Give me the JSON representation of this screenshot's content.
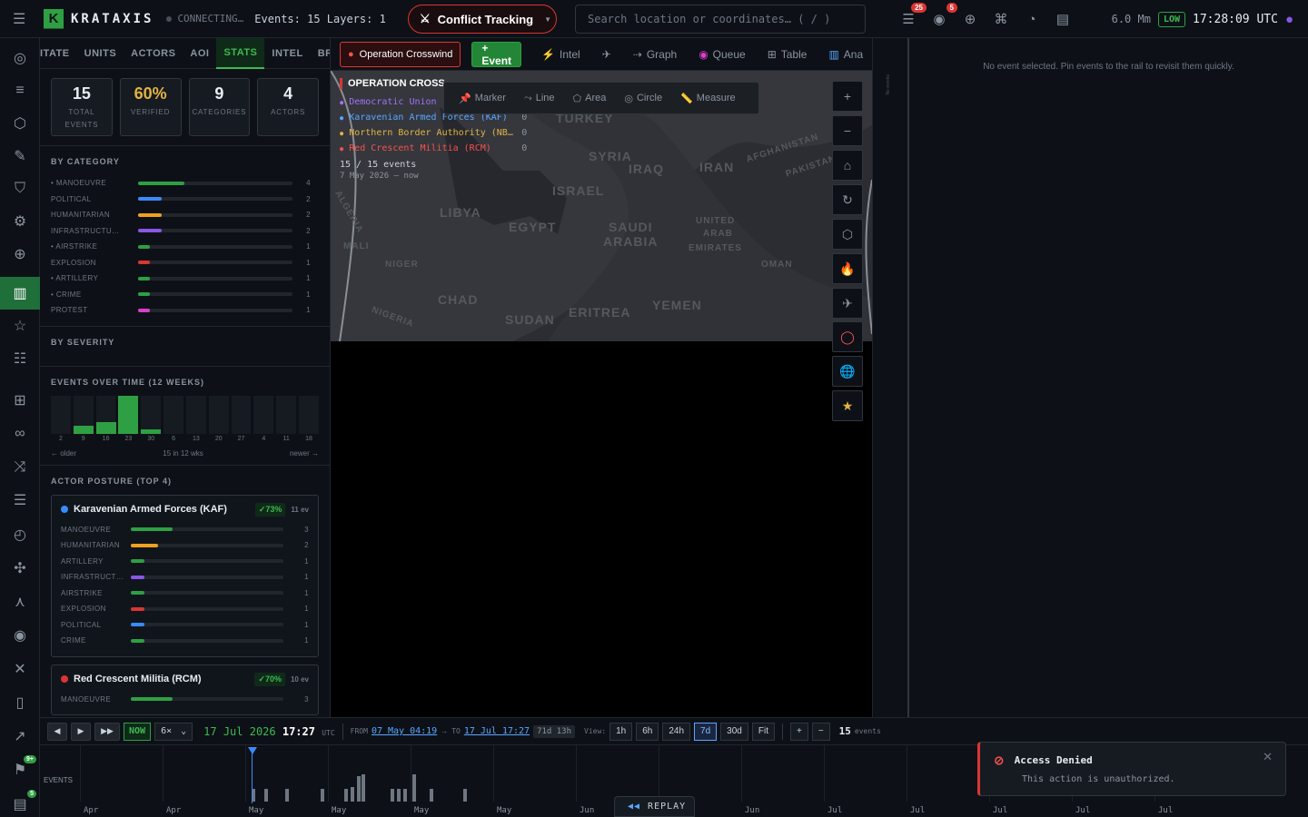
{
  "topbar": {
    "app_name": "KRATAXIS",
    "connection": "CONNECTING…",
    "events_layers": "Events: 15 Layers: 1",
    "mode_button": "Conflict Tracking",
    "search_placeholder": "Search location or coordinates… ( / )",
    "layers_badge": "25",
    "watch_badge": "5",
    "scale": "6.0 Mm",
    "threat_level": "LOW",
    "clock": "17:28:09 UTC"
  },
  "rail": {
    "badge_flag": "9+",
    "badge_doc": "5"
  },
  "stats": {
    "tabs": [
      "ITATE",
      "UNITS",
      "ACTORS",
      "AOI",
      "STATS",
      "INTEL",
      "BROWSI"
    ],
    "kpis": [
      {
        "value": "15",
        "label": "TOTAL EVENTS"
      },
      {
        "value": "60%",
        "label": "VERIFIED"
      },
      {
        "value": "9",
        "label": "CATEGORIES"
      },
      {
        "value": "4",
        "label": "ACTORS"
      }
    ],
    "by_category_title": "BY CATEGORY",
    "categories": [
      {
        "name": "• MANOEUVRE",
        "count": 4,
        "color": "#2ea043"
      },
      {
        "name": "POLITICAL",
        "count": 2,
        "color": "#388bfd"
      },
      {
        "name": "HUMANITARIAN",
        "count": 2,
        "color": "#f0a020"
      },
      {
        "name": "INFRASTRUCTU…",
        "count": 2,
        "color": "#8957e5"
      },
      {
        "name": "• AIRSTRIKE",
        "count": 1,
        "color": "#2ea043"
      },
      {
        "name": "EXPLOSION",
        "count": 1,
        "color": "#da3633"
      },
      {
        "name": "• ARTILLERY",
        "count": 1,
        "color": "#2ea043"
      },
      {
        "name": "• CRIME",
        "count": 1,
        "color": "#2ea043"
      },
      {
        "name": "PROTEST",
        "count": 1,
        "color": "#db3ecb"
      }
    ],
    "by_severity_title": "BY SEVERITY",
    "events_over_time_title": "EVENTS OVER TIME (12 WEEKS)",
    "weeks": [
      {
        "label": "2",
        "value": 0
      },
      {
        "label": "9",
        "value": 2
      },
      {
        "label": "16",
        "value": 3
      },
      {
        "label": "23",
        "value": 10
      },
      {
        "label": "30",
        "value": 1
      },
      {
        "label": "6",
        "value": 0
      },
      {
        "label": "13",
        "value": 0
      },
      {
        "label": "20",
        "value": 0
      },
      {
        "label": "27",
        "value": 0
      },
      {
        "label": "4",
        "value": 0
      },
      {
        "label": "11",
        "value": 0
      },
      {
        "label": "18",
        "value": 0
      }
    ],
    "weeks_max": 10,
    "older": "← older",
    "weeks_summary": "15 in 12 wks",
    "newer": "newer →",
    "actor_posture_title": "ACTOR POSTURE (TOP 4)",
    "actors": [
      {
        "name": "Karavenian Armed Forces (KAF)",
        "color": "#388bfd",
        "pct": "✓73%",
        "events": "11 ev",
        "rows": [
          {
            "name": "MANOEUVRE",
            "count": 3,
            "color": "#2ea043"
          },
          {
            "name": "HUMANITARIAN",
            "count": 2,
            "color": "#f0a020"
          },
          {
            "name": "ARTILLERY",
            "count": 1,
            "color": "#2ea043"
          },
          {
            "name": "INFRASTRUCT…",
            "count": 1,
            "color": "#8957e5"
          },
          {
            "name": "AIRSTRIKE",
            "count": 1,
            "color": "#2ea043"
          },
          {
            "name": "EXPLOSION",
            "count": 1,
            "color": "#da3633"
          },
          {
            "name": "POLITICAL",
            "count": 1,
            "color": "#388bfd"
          },
          {
            "name": "CRIME",
            "count": 1,
            "color": "#2ea043"
          }
        ]
      },
      {
        "name": "Red Crescent Militia (RCM)",
        "color": "#da3633",
        "pct": "✓70%",
        "events": "10 ev",
        "rows": [
          {
            "name": "MANOEUVRE",
            "count": 3,
            "color": "#2ea043"
          }
        ]
      }
    ]
  },
  "maptoolbar": {
    "operation": "Operation Crosswind",
    "event_button": "+ Event",
    "buttons": [
      "Intel",
      "",
      "Graph",
      "Queue",
      "Table",
      "Ana"
    ]
  },
  "map": {
    "legend_title": "OPERATION CROSSWIND",
    "legend_rows": [
      {
        "name": "Democratic Union",
        "count": "",
        "color": "#a371f7"
      },
      {
        "name": "Karavenian Armed Forces (KAF)",
        "count": "0",
        "color": "#58a6ff"
      },
      {
        "name": "Northern Border Authority (NB…",
        "count": "0",
        "color": "#e3b341"
      },
      {
        "name": "Red Crescent Militia (RCM)",
        "count": "0",
        "color": "#f85149"
      }
    ],
    "legend_summary": "15 / 15 events",
    "legend_range": "7 May 2026 – now",
    "draw_tools": [
      "Marker",
      "Line",
      "Area",
      "Circle",
      "Measure"
    ],
    "labels": [
      {
        "text": "TURKEY"
      },
      {
        "text": "SYRIA"
      },
      {
        "text": "IRAQ"
      },
      {
        "text": "IRAN"
      },
      {
        "text": "AFGHANISTAN"
      },
      {
        "text": "PAKISTAN"
      },
      {
        "text": "ISRAEL"
      },
      {
        "text": "LIBYA"
      },
      {
        "text": "EGYPT"
      },
      {
        "text": "SAUDI"
      },
      {
        "text": "ARABIA"
      },
      {
        "text": "UNITED"
      },
      {
        "text": "ARAB"
      },
      {
        "text": "EMIRATES"
      },
      {
        "text": "NIGER"
      },
      {
        "text": "CHAD"
      },
      {
        "text": "SUDAN"
      },
      {
        "text": "ERITREA"
      },
      {
        "text": "YEMEN"
      },
      {
        "text": "MALI"
      },
      {
        "text": "NIGERIA"
      },
      {
        "text": "ALGERIA"
      },
      {
        "text": "OMAN"
      }
    ]
  },
  "vstrip_text": "No events",
  "right": {
    "no_event": "No event selected. Pin events to the rail to revisit them quickly."
  },
  "timebar": {
    "now": "NOW",
    "speed": "6×",
    "date": "17 Jul 2026",
    "time": "17:27",
    "tz": "UTC",
    "from_label": "FROM",
    "from": "07 May 04:19",
    "to_label": "TO",
    "to": "17 Jul 17:27",
    "span": "71d 13h",
    "view_label": "View:",
    "views": [
      "1h",
      "6h",
      "24h",
      "7d",
      "30d",
      "Fit"
    ],
    "active_view": "7d",
    "count": "15",
    "count_label": "events"
  },
  "timeline": {
    "label": "EVENTS",
    "months": [
      "Apr",
      "Apr",
      "May",
      "May",
      "May",
      "May",
      "Jun",
      "Jun",
      "Jun",
      "Jul",
      "Jul",
      "Jul",
      "Jul",
      "Jul"
    ],
    "replay": "REPLAY"
  },
  "toast": {
    "title": "Access Denied",
    "message": "This action is unauthorized."
  }
}
